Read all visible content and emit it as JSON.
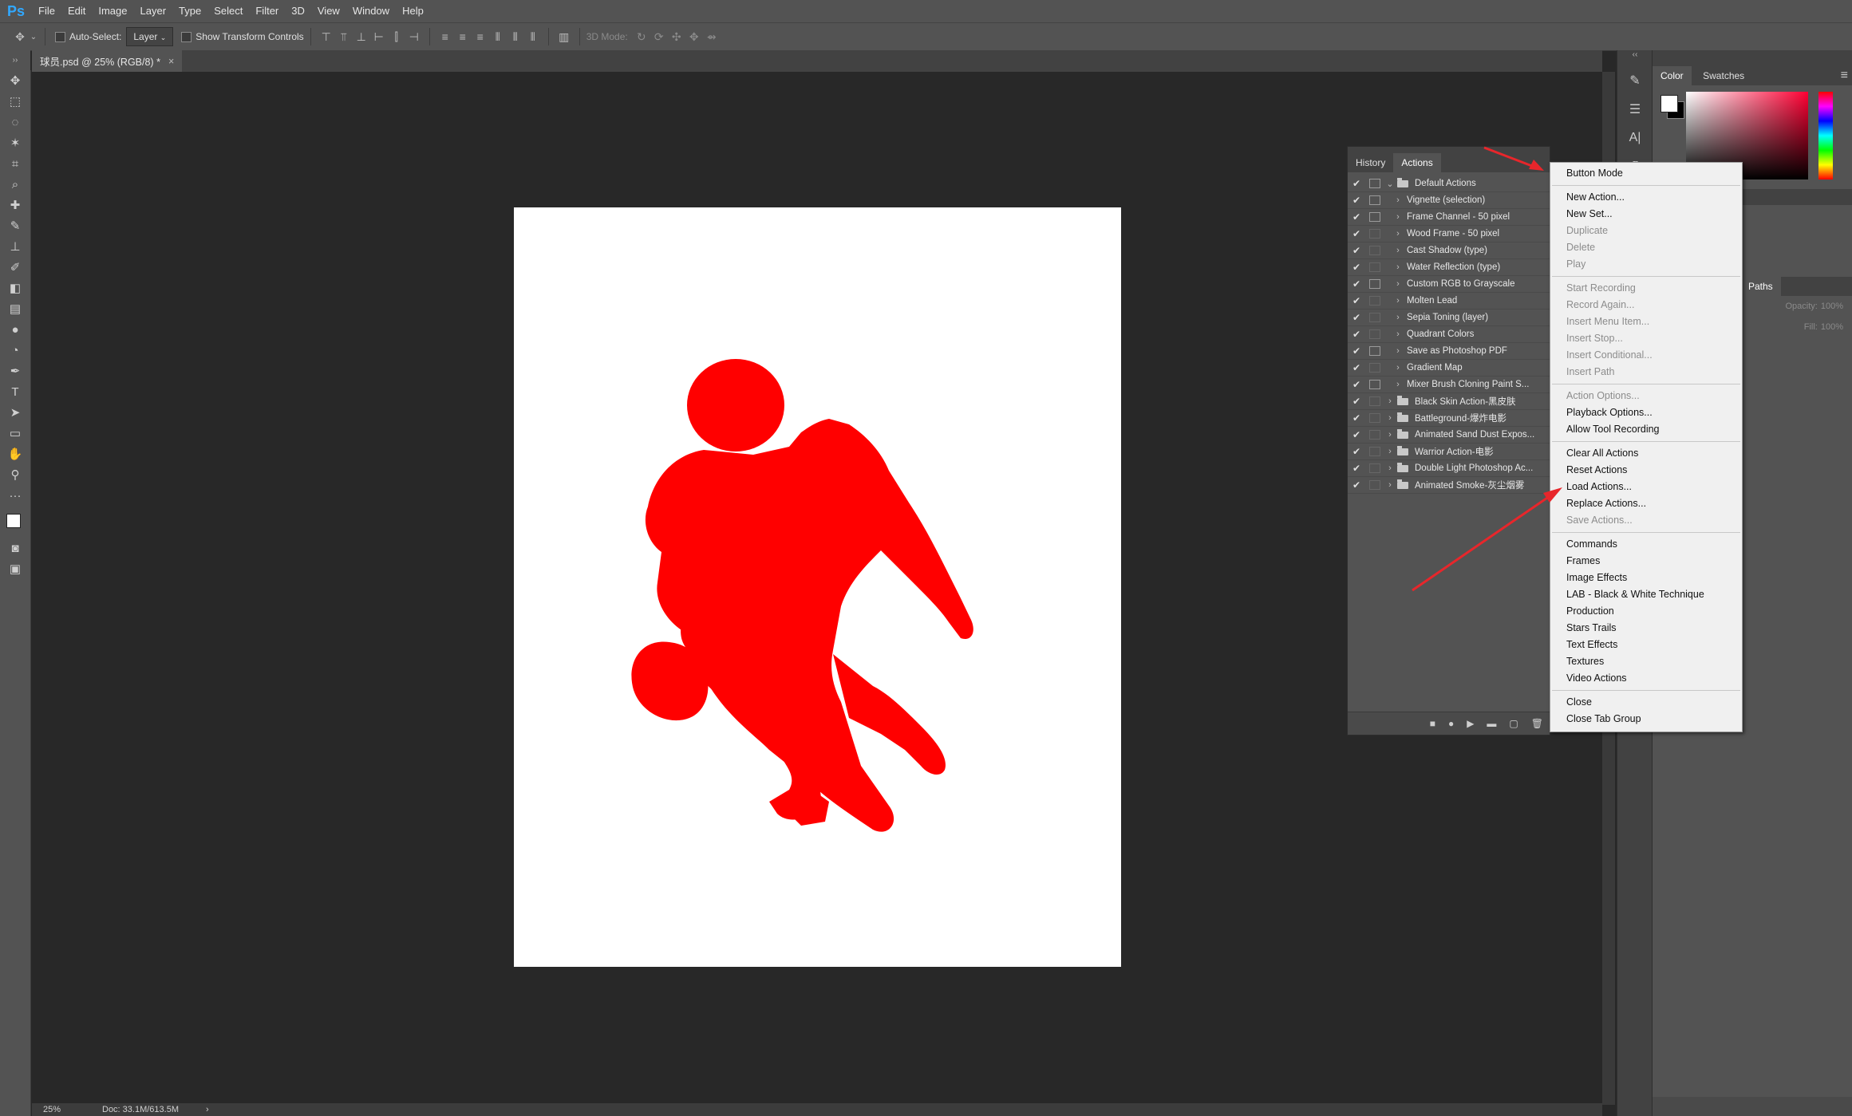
{
  "app": {
    "logo": "Ps"
  },
  "menubar": [
    "File",
    "Edit",
    "Image",
    "Layer",
    "Type",
    "Select",
    "Filter",
    "3D",
    "View",
    "Window",
    "Help"
  ],
  "options": {
    "auto_select": "Auto-Select:",
    "auto_select_value": "Layer",
    "show_transform": "Show Transform Controls",
    "mode_3d": "3D Mode:"
  },
  "document": {
    "tab_title": "球员.psd @ 25% (RGB/8) *",
    "close": "×"
  },
  "status": {
    "zoom": "25%",
    "doc_size": "Doc: 33.1M/613.5M",
    "more": "›"
  },
  "color_panel": {
    "tabs": [
      "Color",
      "Swatches"
    ]
  },
  "layers_panel": {
    "tab": "Paths",
    "opacity_label": "Opacity:",
    "opacity_value": "100%",
    "fill_label": "Fill:",
    "fill_value": "100%"
  },
  "actions_panel": {
    "tabs": [
      "History",
      "Actions"
    ],
    "rows": [
      {
        "check": "✔",
        "toggle": true,
        "indent": 0,
        "arrow": "⌄",
        "folder": true,
        "label": "Default Actions"
      },
      {
        "check": "✔",
        "toggle": true,
        "indent": 1,
        "arrow": "›",
        "folder": false,
        "label": "Vignette (selection)"
      },
      {
        "check": "✔",
        "toggle": true,
        "indent": 1,
        "arrow": "›",
        "folder": false,
        "label": "Frame Channel - 50 pixel"
      },
      {
        "check": "✔",
        "toggle": false,
        "indent": 1,
        "arrow": "›",
        "folder": false,
        "label": "Wood Frame - 50 pixel"
      },
      {
        "check": "✔",
        "toggle": false,
        "indent": 1,
        "arrow": "›",
        "folder": false,
        "label": "Cast Shadow (type)"
      },
      {
        "check": "✔",
        "toggle": false,
        "indent": 1,
        "arrow": "›",
        "folder": false,
        "label": "Water Reflection (type)"
      },
      {
        "check": "✔",
        "toggle": true,
        "indent": 1,
        "arrow": "›",
        "folder": false,
        "label": "Custom RGB to Grayscale"
      },
      {
        "check": "✔",
        "toggle": false,
        "indent": 1,
        "arrow": "›",
        "folder": false,
        "label": "Molten Lead"
      },
      {
        "check": "✔",
        "toggle": false,
        "indent": 1,
        "arrow": "›",
        "folder": false,
        "label": "Sepia Toning (layer)"
      },
      {
        "check": "✔",
        "toggle": false,
        "indent": 1,
        "arrow": "›",
        "folder": false,
        "label": "Quadrant Colors"
      },
      {
        "check": "✔",
        "toggle": true,
        "indent": 1,
        "arrow": "›",
        "folder": false,
        "label": "Save as Photoshop PDF"
      },
      {
        "check": "✔",
        "toggle": false,
        "indent": 1,
        "arrow": "›",
        "folder": false,
        "label": "Gradient Map"
      },
      {
        "check": "✔",
        "toggle": true,
        "indent": 1,
        "arrow": "›",
        "folder": false,
        "label": "Mixer Brush Cloning Paint S..."
      },
      {
        "check": "✔",
        "toggle": false,
        "indent": 0,
        "arrow": "›",
        "folder": true,
        "label": "Black Skin Action-黑皮肤"
      },
      {
        "check": "✔",
        "toggle": false,
        "indent": 0,
        "arrow": "›",
        "folder": true,
        "label": "Battleground-爆炸电影"
      },
      {
        "check": "✔",
        "toggle": false,
        "indent": 0,
        "arrow": "›",
        "folder": true,
        "label": "Animated Sand Dust Expos..."
      },
      {
        "check": "✔",
        "toggle": false,
        "indent": 0,
        "arrow": "›",
        "folder": true,
        "label": "Warrior Action-电影"
      },
      {
        "check": "✔",
        "toggle": false,
        "indent": 0,
        "arrow": "›",
        "folder": true,
        "label": "Double Light Photoshop Ac..."
      },
      {
        "check": "✔",
        "toggle": false,
        "indent": 0,
        "arrow": "›",
        "folder": true,
        "label": "Animated Smoke-灰尘烟雾"
      }
    ],
    "footer": [
      "■",
      "●",
      "▶",
      "▬",
      "▢",
      "🗑"
    ]
  },
  "flyout": {
    "groups": [
      [
        {
          "label": "Button Mode",
          "enabled": true
        }
      ],
      [
        {
          "label": "New Action...",
          "enabled": true
        },
        {
          "label": "New Set...",
          "enabled": true
        },
        {
          "label": "Duplicate",
          "enabled": false
        },
        {
          "label": "Delete",
          "enabled": false
        },
        {
          "label": "Play",
          "enabled": false
        }
      ],
      [
        {
          "label": "Start Recording",
          "enabled": false
        },
        {
          "label": "Record Again...",
          "enabled": false
        },
        {
          "label": "Insert Menu Item...",
          "enabled": false
        },
        {
          "label": "Insert Stop...",
          "enabled": false
        },
        {
          "label": "Insert Conditional...",
          "enabled": false
        },
        {
          "label": "Insert Path",
          "enabled": false
        }
      ],
      [
        {
          "label": "Action Options...",
          "enabled": false
        },
        {
          "label": "Playback Options...",
          "enabled": true
        },
        {
          "label": "Allow Tool Recording",
          "enabled": true
        }
      ],
      [
        {
          "label": "Clear All Actions",
          "enabled": true
        },
        {
          "label": "Reset Actions",
          "enabled": true
        },
        {
          "label": "Load Actions...",
          "enabled": true
        },
        {
          "label": "Replace Actions...",
          "enabled": true
        },
        {
          "label": "Save Actions...",
          "enabled": false
        }
      ],
      [
        {
          "label": "Commands",
          "enabled": true
        },
        {
          "label": "Frames",
          "enabled": true
        },
        {
          "label": "Image Effects",
          "enabled": true
        },
        {
          "label": "LAB - Black & White Technique",
          "enabled": true
        },
        {
          "label": "Production",
          "enabled": true
        },
        {
          "label": "Stars Trails",
          "enabled": true
        },
        {
          "label": "Text Effects",
          "enabled": true
        },
        {
          "label": "Textures",
          "enabled": true
        },
        {
          "label": "Video Actions",
          "enabled": true
        }
      ],
      [
        {
          "label": "Close",
          "enabled": true
        },
        {
          "label": "Close Tab Group",
          "enabled": true
        }
      ]
    ]
  },
  "colors": {
    "accent_red": "#ff0000",
    "annotation_arrow": "#e8262b"
  }
}
